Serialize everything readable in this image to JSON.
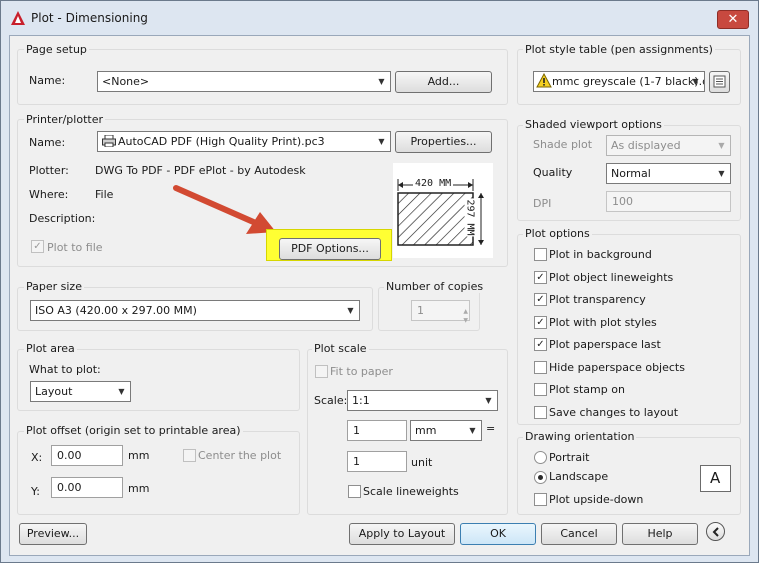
{
  "window": {
    "title": "Plot - Dimensioning",
    "close_glyph": "✕"
  },
  "page_setup": {
    "group_label": "Page setup",
    "name_label": "Name:",
    "name_value": "<None>",
    "add_button": "Add..."
  },
  "printer": {
    "group_label": "Printer/plotter",
    "name_label": "Name:",
    "name_value": "AutoCAD PDF (High Quality Print).pc3",
    "properties_button": "Properties...",
    "plotter_label": "Plotter:",
    "plotter_value": "DWG To PDF - PDF ePlot - by Autodesk",
    "where_label": "Where:",
    "where_value": "File",
    "description_label": "Description:",
    "plot_to_file_label": "Plot to file",
    "plot_to_file_checked": true,
    "pdf_options_button": "PDF Options...",
    "preview_width_text": "420  MM",
    "preview_height_text": "297  MM"
  },
  "paper_size": {
    "group_label": "Paper size",
    "value": "ISO A3 (420.00 x 297.00 MM)"
  },
  "copies": {
    "group_label": "Number of copies",
    "value": "1"
  },
  "plot_area": {
    "group_label": "Plot area",
    "what_label": "What to plot:",
    "what_value": "Layout"
  },
  "plot_offset": {
    "group_label": "Plot offset (origin set to printable area)",
    "x_label": "X:",
    "x_value": "0.00",
    "x_unit": "mm",
    "y_label": "Y:",
    "y_value": "0.00",
    "y_unit": "mm",
    "center_label": "Center the plot"
  },
  "plot_scale": {
    "group_label": "Plot scale",
    "fit_label": "Fit to paper",
    "scale_label": "Scale:",
    "scale_value": "1:1",
    "value1": "1",
    "unit_value": "mm",
    "equals": "=",
    "value2": "1",
    "unit2": "unit",
    "lineweights_label": "Scale lineweights"
  },
  "plot_style": {
    "group_label": "Plot style table (pen assignments)",
    "value": "mmc greyscale (1-7 black).c"
  },
  "shaded": {
    "group_label": "Shaded viewport options",
    "shade_label": "Shade plot",
    "shade_value": "As displayed",
    "quality_label": "Quality",
    "quality_value": "Normal",
    "dpi_label": "DPI",
    "dpi_value": "100"
  },
  "plot_options": {
    "group_label": "Plot options",
    "items": [
      {
        "label": "Plot in background",
        "checked": false
      },
      {
        "label": "Plot object lineweights",
        "checked": true
      },
      {
        "label": "Plot transparency",
        "checked": true
      },
      {
        "label": "Plot with plot styles",
        "checked": true
      },
      {
        "label": "Plot paperspace last",
        "checked": true
      },
      {
        "label": "Hide paperspace objects",
        "checked": false
      },
      {
        "label": "Plot stamp on",
        "checked": false
      },
      {
        "label": "Save changes to layout",
        "checked": false
      }
    ]
  },
  "orientation": {
    "group_label": "Drawing orientation",
    "portrait_label": "Portrait",
    "landscape_label": "Landscape",
    "selected": "Landscape",
    "upside_label": "Plot upside-down",
    "icon_letter": "A"
  },
  "footer": {
    "preview_button": "Preview...",
    "apply_button": "Apply to Layout",
    "ok_button": "OK",
    "cancel_button": "Cancel",
    "help_button": "Help"
  },
  "colors": {
    "highlight": "#ffff33",
    "arrow": "#d24a32",
    "close": "#c8493f"
  }
}
